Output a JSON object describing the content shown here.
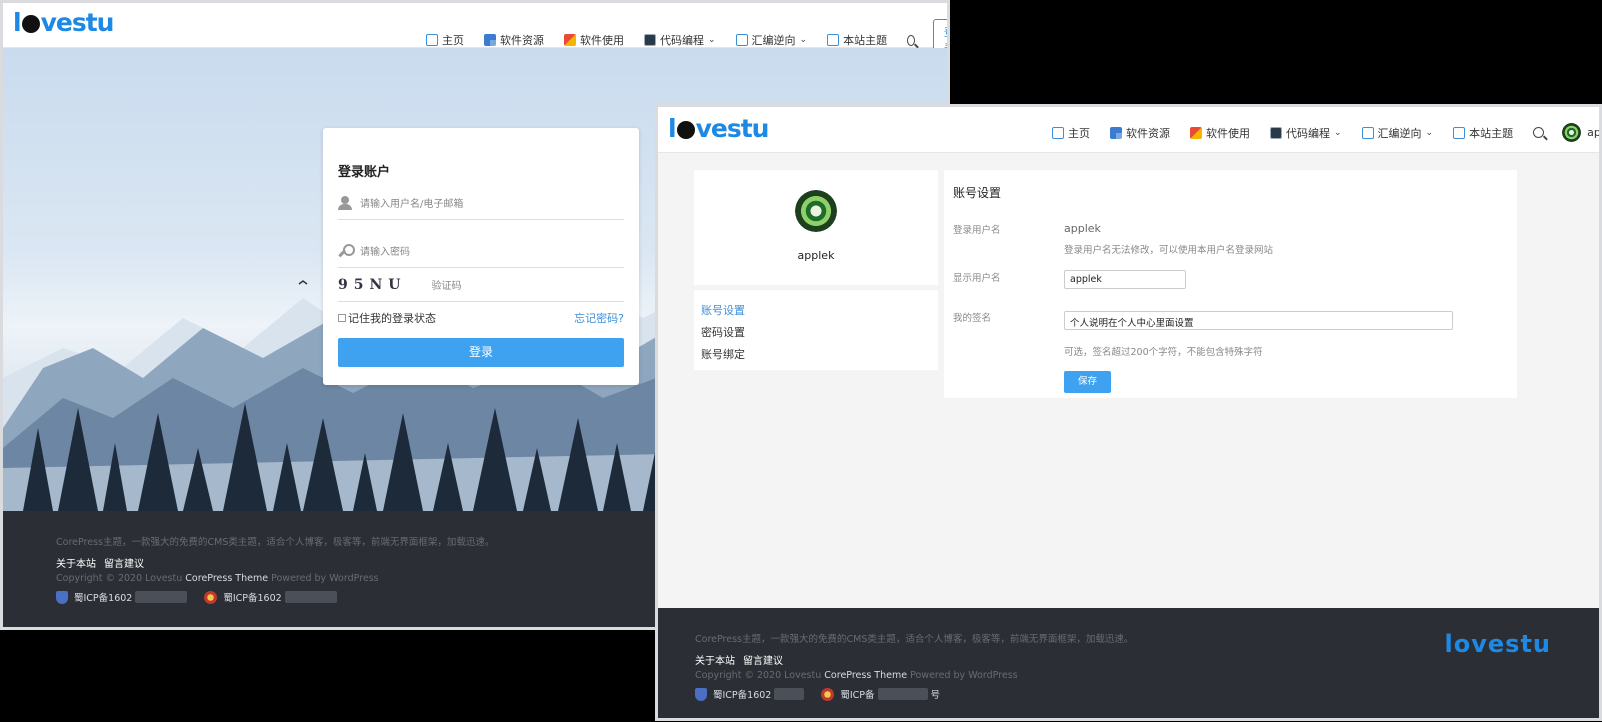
{
  "login_window": {
    "logo": "lovestu",
    "nav": [
      {
        "label": "主页",
        "icon": "home-icon"
      },
      {
        "label": "软件资源",
        "icon": "software-icon"
      },
      {
        "label": "软件使用",
        "icon": "apps-icon"
      },
      {
        "label": "代码编程",
        "icon": "code-icon",
        "dropdown": true
      },
      {
        "label": "汇编逆向",
        "icon": "shield-icon",
        "dropdown": true
      },
      {
        "label": "本站主题",
        "icon": "theme-icon"
      }
    ],
    "login_button": "登录",
    "form": {
      "title": "登录账户",
      "username_placeholder": "请输入用户名/电子邮箱",
      "password_placeholder": "请输入密码",
      "captcha_text": "95NU",
      "captcha_placeholder": "验证码",
      "remember_label": "记住我的登录状态",
      "forgot_label": "忘记密码?",
      "submit_label": "登录"
    },
    "footer": {
      "description": "CorePress主题，一款强大的免费的CMS类主题，适合个人博客，极客等，前端无界面框架，加载迅速。",
      "links": [
        "关于本站",
        "留言建议"
      ],
      "copyright_prefix": "Copyright © 2020 Lovestu",
      "theme_name": "CorePress Theme",
      "powered": "Powered by WordPress",
      "icp1": "蜀ICP备1602",
      "icp2": "蜀ICP备1602"
    }
  },
  "settings_window": {
    "logo": "lovestu",
    "nav": [
      {
        "label": "主页",
        "icon": "home-icon"
      },
      {
        "label": "软件资源",
        "icon": "software-icon"
      },
      {
        "label": "软件使用",
        "icon": "apps-icon"
      },
      {
        "label": "代码编程",
        "icon": "code-icon",
        "dropdown": true
      },
      {
        "label": "汇编逆向",
        "icon": "shield-icon",
        "dropdown": true
      },
      {
        "label": "本站主题",
        "icon": "theme-icon"
      }
    ],
    "user": "applek",
    "profile_name": "applek",
    "menu": [
      "账号设置",
      "密码设置",
      "账号绑定"
    ],
    "panel": {
      "title": "账号设置",
      "login_name_label": "登录用户名",
      "login_name_value": "applek",
      "login_name_hint": "登录用户名无法修改，可以使用本用户名登录网站",
      "display_name_label": "显示用户名",
      "display_name_value": "applek",
      "signature_label": "我的签名",
      "signature_value": "个人说明在个人中心里面设置",
      "signature_hint": "可选，签名超过200个字符，不能包含特殊字符",
      "save_label": "保存"
    },
    "footer": {
      "description": "CorePress主题，一款强大的免费的CMS类主题，适合个人博客，极客等，前端无界面框架，加载迅速。",
      "links": [
        "关于本站",
        "留言建议"
      ],
      "copyright_prefix": "Copyright © 2020 Lovestu",
      "theme_name": "CorePress Theme",
      "powered": "Powered by WordPress",
      "icp1": "蜀ICP备1602",
      "icp2": "蜀ICP备",
      "icp2_suffix": "号",
      "footer_logo": "lovestu"
    }
  },
  "colors": {
    "accent": "#3ea2f0",
    "link": "#3b8fd8",
    "footer_bg": "#2b2f35",
    "logo": "#1e88e5"
  }
}
